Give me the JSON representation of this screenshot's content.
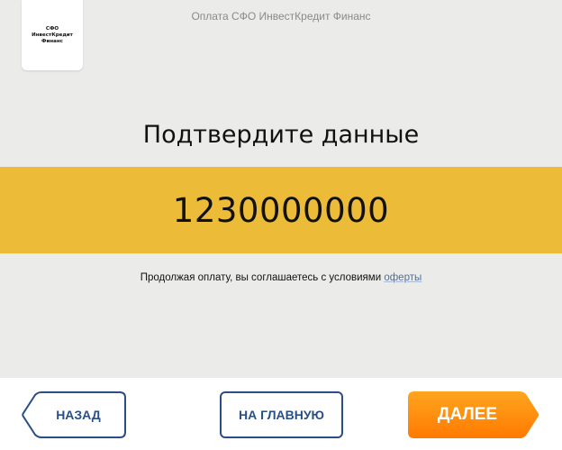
{
  "header": {
    "logo_text": "СФО ИнвестКредит Финанс",
    "title": "Оплата СФО ИнвестКредит Финанс"
  },
  "main": {
    "heading": "Подтвердите данные",
    "amount": "1230000000",
    "agreement_text": "Продолжая оплату, вы соглашаетесь с условиями ",
    "offer_link": "оферты"
  },
  "footer": {
    "back_label": "НАЗАД",
    "home_label": "НА ГЛАВНУЮ",
    "next_label": "ДАЛЕЕ"
  },
  "colors": {
    "amount_band": "#ecbc38",
    "button_outline": "#2a4f86",
    "next_button_top": "#ffa51f",
    "next_button_bottom": "#ff7a00",
    "link": "#4a6fa5"
  }
}
